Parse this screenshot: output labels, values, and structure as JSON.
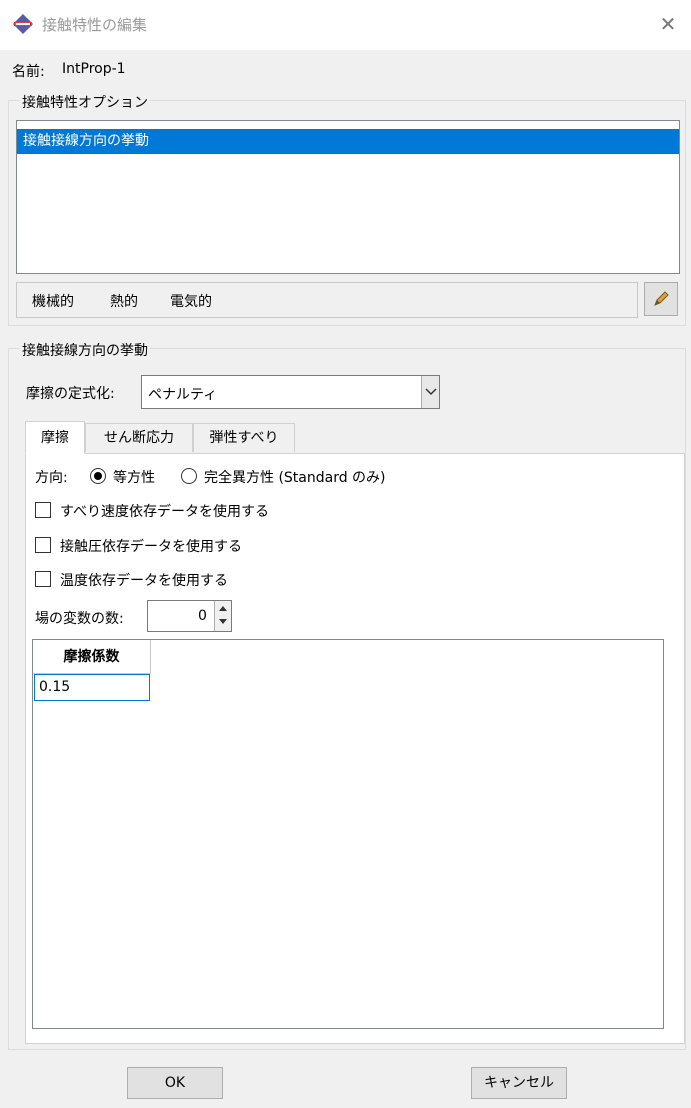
{
  "window": {
    "title": "接触特性の編集",
    "close_glyph": "✕"
  },
  "name_row": {
    "label": "名前:",
    "value": "IntProp-1"
  },
  "options_group": {
    "title": "接触特性オプション",
    "items": [
      "接触接線方向の挙動"
    ],
    "selected_index": 0,
    "menu": [
      "機械的",
      "熱的",
      "電気的"
    ]
  },
  "behavior_group": {
    "title": "接触接線方向の挙動",
    "formulation": {
      "label": "摩擦の定式化:",
      "value": "ペナルティ"
    },
    "tabs": [
      "摩擦",
      "せん断応力",
      "弾性すべり"
    ],
    "active_tab": 0,
    "direction": {
      "label": "方向:",
      "options": [
        "等方性",
        "完全異方性 (Standard のみ)"
      ],
      "selected": 0
    },
    "checkboxes": [
      {
        "label": "すべり速度依存データを使用する",
        "checked": false
      },
      {
        "label": "接触圧依存データを使用する",
        "checked": false
      },
      {
        "label": "温度依存データを使用する",
        "checked": false
      }
    ],
    "field_vars": {
      "label": "場の変数の数:",
      "value": "0"
    },
    "table": {
      "header": "摩擦係数",
      "rows": [
        "0.15"
      ]
    }
  },
  "buttons": {
    "ok": "OK",
    "cancel": "キャンセル"
  },
  "colors": {
    "selection": "#0078d7",
    "background": "#f0f0f0",
    "title_text": "#9a9a9a"
  },
  "icons": [
    "app-icon",
    "close-icon",
    "edit-icon",
    "chevron-down-icon",
    "spin-up-icon",
    "spin-down-icon"
  ]
}
